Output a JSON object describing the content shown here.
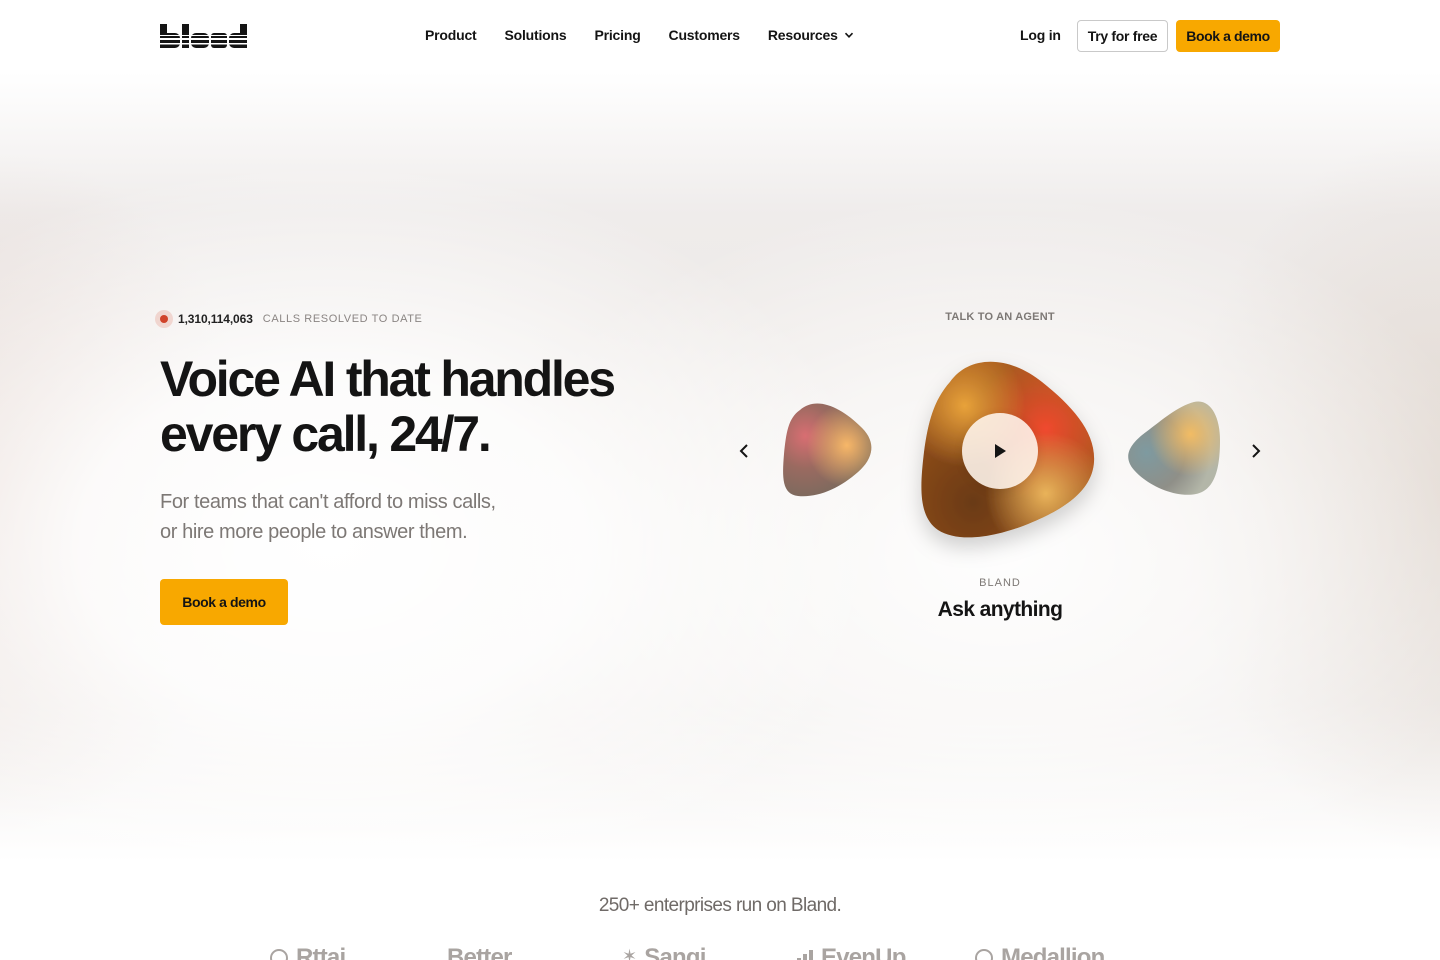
{
  "nav": {
    "brand": "bland",
    "links": [
      {
        "label": "Product"
      },
      {
        "label": "Solutions"
      },
      {
        "label": "Pricing"
      },
      {
        "label": "Customers"
      },
      {
        "label": "Resources",
        "icon": "chevron-down-icon"
      }
    ],
    "login": "Log in",
    "try_free": "Try for free",
    "book_demo": "Book a demo"
  },
  "hero": {
    "counter_value": "1,310,114,063",
    "counter_label": "CALLS RESOLVED TO DATE",
    "headline": "Voice AI that handles every call, 24/7.",
    "subhead_line1": "For teams that can't afford to miss calls,",
    "subhead_line2": "or hire more people to answer them.",
    "cta": "Book a demo"
  },
  "agent": {
    "section_label": "TALK TO AN AGENT",
    "name": "BLAND",
    "tagline": "Ask anything",
    "prev_icon": "chevron-left-icon",
    "next_icon": "chevron-right-icon",
    "play_icon": "play-icon"
  },
  "logos_section": {
    "title": "250+ enterprises run on Bland.",
    "logos": [
      "Rttai",
      "Better",
      "Sangi",
      "EvenUp",
      "Medallion"
    ]
  },
  "colors": {
    "accent": "#f8a800",
    "text": "#141414",
    "muted": "#7d7875",
    "live_dot": "#d0432a"
  }
}
